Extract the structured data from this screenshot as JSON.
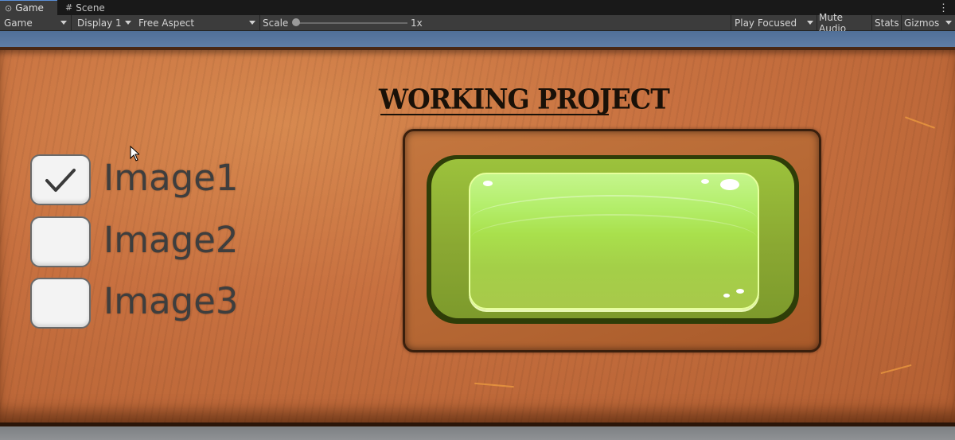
{
  "tabs": [
    {
      "label": "Game",
      "icon": "gamepad-icon",
      "active": true
    },
    {
      "label": "Scene",
      "icon": "grid-icon",
      "active": false
    }
  ],
  "toolbar": {
    "game_view_dropdown": "Game",
    "display_dropdown": "Display 1",
    "aspect_dropdown": "Free Aspect",
    "scale_label": "Scale",
    "scale_value": "1x",
    "play_mode_dropdown": "Play Focused",
    "mute_audio": "Mute Audio",
    "stats": "Stats",
    "gizmos": "Gizmos"
  },
  "game": {
    "title": "WORKING PROJECT",
    "options": [
      {
        "label": "Image1",
        "checked": true
      },
      {
        "label": "Image2",
        "checked": false
      },
      {
        "label": "Image3",
        "checked": false
      }
    ],
    "colors": {
      "board": "#c87140",
      "gel_button": "#a9e04c",
      "toolbar": "#3c3c3c",
      "accent": "#5a8fd8"
    }
  }
}
